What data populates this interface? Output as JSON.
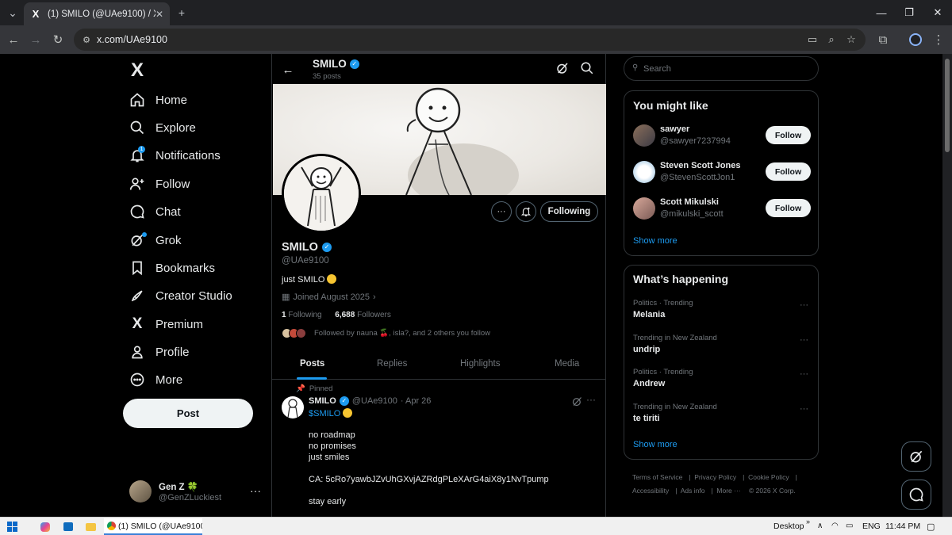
{
  "browser": {
    "tab_title": "(1) SMILO (@UAe9100) / X",
    "tab_favicon": "X",
    "url": "x.com/UAe9100"
  },
  "nav": {
    "logo": "X",
    "items": [
      {
        "label": "Home",
        "icon": "home-icon"
      },
      {
        "label": "Explore",
        "icon": "search-icon"
      },
      {
        "label": "Notifications",
        "icon": "bell-icon",
        "badge": "1"
      },
      {
        "label": "Follow",
        "icon": "person-add-icon"
      },
      {
        "label": "Chat",
        "icon": "chat-icon"
      },
      {
        "label": "Grok",
        "icon": "grok-icon"
      },
      {
        "label": "Bookmarks",
        "icon": "bookmark-icon"
      },
      {
        "label": "Creator Studio",
        "icon": "rocket-icon"
      },
      {
        "label": "Premium",
        "icon": "x-logo-icon"
      },
      {
        "label": "Profile",
        "icon": "person-icon"
      },
      {
        "label": "More",
        "icon": "more-circle-icon"
      }
    ],
    "post_label": "Post",
    "account": {
      "name": "Gen Z 🍀",
      "handle": "@GenZLuckiest"
    }
  },
  "profile": {
    "header_name": "SMILO",
    "posts_count": "35 posts",
    "name": "SMILO",
    "handle": "@UAe9100",
    "bio": "just SMILO",
    "joined": "Joined August 2025",
    "following_count": "1",
    "following_label": "Following",
    "followers_count": "6,688",
    "followers_label": "Followers",
    "followed_by": "Followed by nauna 🍒, isla?, and 2 others you follow",
    "following_button": "Following",
    "tabs": [
      "Posts",
      "Replies",
      "Highlights",
      "Media"
    ]
  },
  "tweet": {
    "pinned_label": "Pinned",
    "name": "SMILO",
    "handle": "@UAe9100",
    "date": "· Apr 26",
    "cashtag": "$SMILO",
    "lines": [
      "no roadmap",
      "no promises",
      "just smiles",
      "CA: 5cRo7yawbJZvUhGXvjAZRdgPLeXArG4aiX8y1NvTpump",
      "stay early"
    ]
  },
  "sidebar": {
    "search_placeholder": "Search",
    "you_might_like": "You might like",
    "suggestions": [
      {
        "name": "sawyer",
        "handle": "@sawyer7237994",
        "button": "Follow"
      },
      {
        "name": "Steven Scott Jones",
        "handle": "@StevenScottJon1",
        "button": "Follow"
      },
      {
        "name": "Scott Mikulski",
        "handle": "@mikulski_scott",
        "button": "Follow"
      }
    ],
    "show_more": "Show more",
    "whats_happening": "What’s happening",
    "trends": [
      {
        "context": "Politics · Trending",
        "title": "Melania"
      },
      {
        "context": "Trending in New Zealand",
        "title": "undrip"
      },
      {
        "context": "Politics · Trending",
        "title": "Andrew"
      },
      {
        "context": "Trending in New Zealand",
        "title": "te tiriti"
      }
    ],
    "show_more_2": "Show more",
    "footer": [
      "Terms of Service",
      "Privacy Policy",
      "Cookie Policy",
      "Accessibility",
      "Ads info",
      "More ···",
      "© 2026 X Corp."
    ]
  },
  "taskbar": {
    "task_label": "(1) SMILO (@UAe9100...",
    "desktop": "Desktop",
    "lang": "ENG",
    "time": "11:44 PM"
  },
  "colors": {
    "accent": "#1d9bf0",
    "background": "#000000",
    "border": "#2f3336",
    "muted": "#71767b"
  }
}
